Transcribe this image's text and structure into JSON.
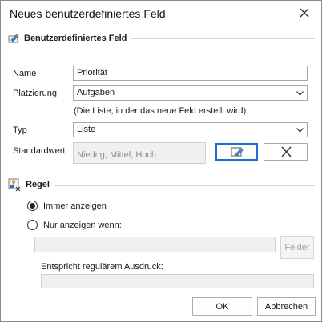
{
  "window": {
    "title": "Neues benutzerdefiniertes Feld"
  },
  "section_field": {
    "title": "Benutzerdefiniertes Feld"
  },
  "name": {
    "label": "Name",
    "value": "Priorität"
  },
  "placement": {
    "label": "Platzierung",
    "value": "Aufgaben",
    "hint": "(Die Liste, in der das neue Feld erstellt wird)"
  },
  "type": {
    "label": "Typ",
    "value": "Liste"
  },
  "default": {
    "label": "Standardwert",
    "value": "Niedrig; Mittel; Hoch"
  },
  "section_rule": {
    "title": "Regel"
  },
  "rule": {
    "always_label": "Immer anzeigen",
    "always_selected": true,
    "conditional_label": "Nur anzeigen wenn:",
    "conditional_selected": false,
    "condition_value": "",
    "fields_button": "Felder",
    "regex_label": "Entspricht regulärem Ausdruck:",
    "regex_value": ""
  },
  "buttons": {
    "ok": "OK",
    "cancel": "Abbrechen"
  },
  "colors": {
    "focus": "#1f6fd0",
    "border": "#a8a8a8",
    "disabled_bg": "#f0f0f0"
  },
  "icons": [
    "close-icon",
    "custom-field-icon",
    "dropdown-arrow-icon",
    "edit-list-icon",
    "clear-x-icon",
    "rule-icon"
  ]
}
